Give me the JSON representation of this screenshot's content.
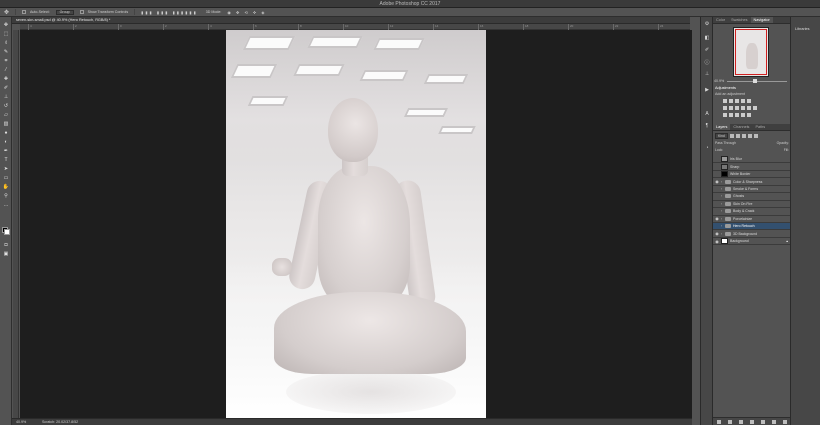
{
  "app": {
    "title": "Adobe Photoshop CC 2017"
  },
  "options_bar": {
    "auto_select": "Auto-Select:",
    "auto_select_target": "Group",
    "show_transform": "Show Transform Controls",
    "mode_3d": "3D Mode:"
  },
  "document": {
    "tab_title": "seven-skn-small.psd @ 40.9% (Hero Retouch, RGB/8) *",
    "zoom": "40.9%",
    "doc_info": "Scratch: 20.02/37.8/52"
  },
  "ruler": {
    "ticks": [
      "4",
      "2",
      "0",
      "2",
      "4",
      "6",
      "8",
      "10",
      "12",
      "14",
      "16",
      "18",
      "20",
      "22",
      "24"
    ]
  },
  "navigator": {
    "tabs": [
      "Color",
      "Swatches",
      "Navigator"
    ],
    "active_tab": "Navigator",
    "zoom": "40.9%"
  },
  "adjustments": {
    "title": "Adjustments",
    "subtitle": "Add an adjustment"
  },
  "layers_panel": {
    "tabs": [
      "Layers",
      "Channels",
      "Paths"
    ],
    "active_tab": "Layers",
    "kind_filter": "Kind",
    "blend_mode": "Pass Through",
    "opacity_label": "Opacity:",
    "lock_label": "Lock:",
    "fill_label": "Fill:",
    "layers": [
      {
        "name": "Iris Blur",
        "visible": false,
        "type": "smart",
        "selected": false
      },
      {
        "name": "Sharp",
        "visible": false,
        "type": "pixel",
        "selected": false
      },
      {
        "name": "White Border",
        "visible": false,
        "type": "black",
        "selected": false
      },
      {
        "name": "Color & Sharpness",
        "visible": true,
        "type": "group",
        "selected": false
      },
      {
        "name": "Smoke & Forms",
        "visible": false,
        "type": "group",
        "selected": false
      },
      {
        "name": "Ghosts",
        "visible": false,
        "type": "group",
        "selected": false
      },
      {
        "name": "Skin On Fire",
        "visible": false,
        "type": "group",
        "selected": false
      },
      {
        "name": "Body & Crack",
        "visible": false,
        "type": "group",
        "selected": false
      },
      {
        "name": "Porcelainize",
        "visible": true,
        "type": "group",
        "selected": false
      },
      {
        "name": "Hero Retouch",
        "visible": false,
        "type": "group",
        "selected": true
      },
      {
        "name": "3D Background",
        "visible": true,
        "type": "group",
        "selected": false
      },
      {
        "name": "Background",
        "visible": true,
        "type": "white",
        "selected": false,
        "locked": true
      }
    ]
  },
  "libraries": {
    "label": "Libraries"
  },
  "colors": {
    "selection": "#33506f",
    "panel": "#535353",
    "canvas_bg": "#1e1e1e"
  }
}
